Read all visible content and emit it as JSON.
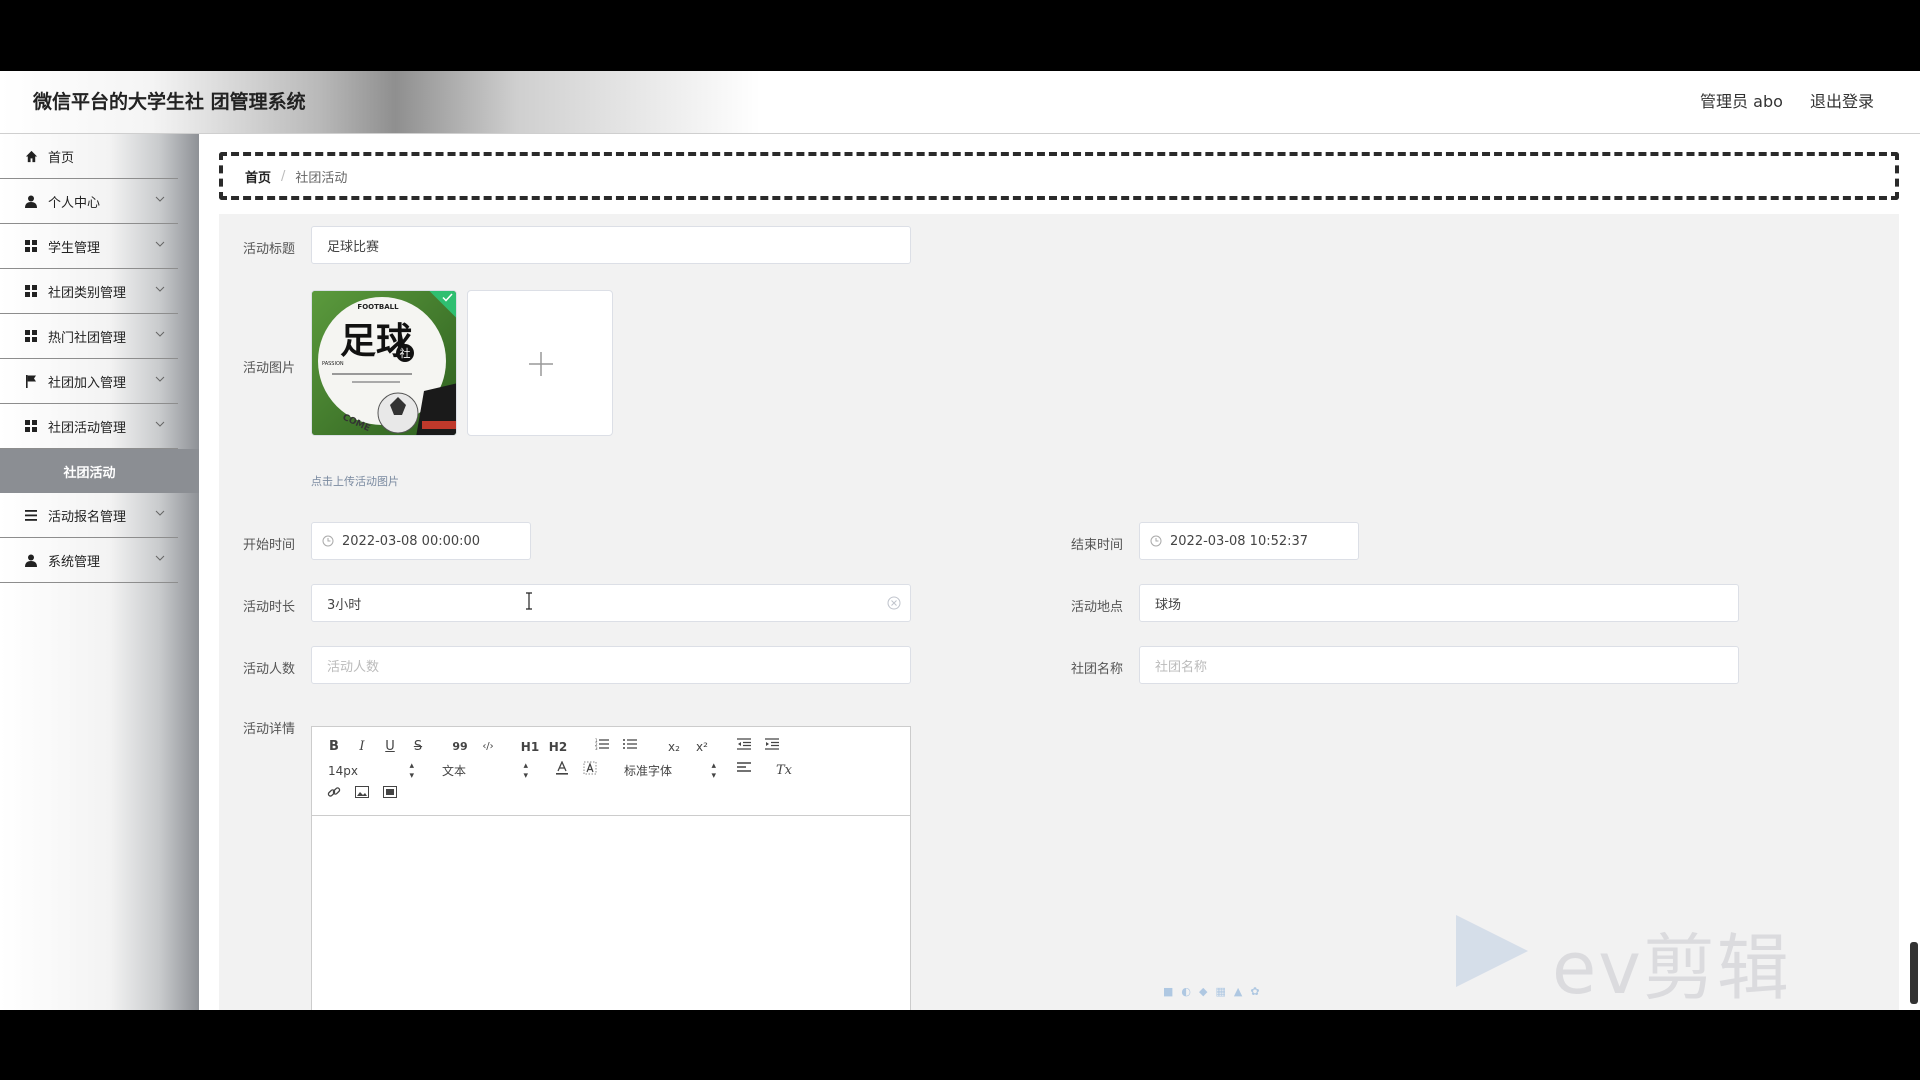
{
  "header": {
    "title": "微信平台的大学生社 团管理系统",
    "admin_label": "管理员 abo",
    "logout_label": "退出登录"
  },
  "sidebar": {
    "items": [
      {
        "label": "首页",
        "icon": "home-icon"
      },
      {
        "label": "个人中心",
        "icon": "user-icon"
      },
      {
        "label": "学生管理",
        "icon": "grid-icon"
      },
      {
        "label": "社团类别管理",
        "icon": "grid-icon"
      },
      {
        "label": "热门社团管理",
        "icon": "grid-icon"
      },
      {
        "label": "社团加入管理",
        "icon": "flag-icon"
      },
      {
        "label": "社团活动管理",
        "icon": "grid-icon"
      },
      {
        "label": "活动报名管理",
        "icon": "list-icon"
      },
      {
        "label": "系统管理",
        "icon": "user-icon"
      }
    ],
    "active_sub": "社团活动"
  },
  "breadcrumb": {
    "home": "首页",
    "separator": "/",
    "current": "社团活动"
  },
  "form": {
    "title_label": "活动标题",
    "title_value": "足球比赛",
    "image_label": "活动图片",
    "image_hint": "点击上传活动图片",
    "image_thumb": {
      "top_text": "FOOTBALL",
      "main_text": "足球",
      "badge_text": "社",
      "side_text": "PASSION",
      "bottom_text": "COME"
    },
    "start_label": "开始时间",
    "start_value": "2022-03-08 00:00:00",
    "end_label": "结束时间",
    "end_value": "2022-03-08 10:52:37",
    "duration_label": "活动时长",
    "duration_value": "3小时",
    "location_label": "活动地点",
    "location_value": "球场",
    "people_label": "活动人数",
    "people_placeholder": "活动人数",
    "club_label": "社团名称",
    "club_placeholder": "社团名称",
    "detail_label": "活动详情"
  },
  "editor": {
    "bold": "B",
    "italic": "I",
    "underline": "U",
    "strike": "S",
    "quote": "99",
    "code": "‹/›",
    "h1": "H1",
    "h2": "H2",
    "sub": "x₂",
    "sup": "x²",
    "size_value": "14px",
    "type_value": "文本",
    "font_value": "标准字体",
    "clean": "Tx"
  },
  "watermark": {
    "text": "ev剪辑"
  },
  "colors": {
    "active_submenu": "#8b8e93",
    "form_background": "#f2f2f2",
    "check_badge": "#2fbf71"
  }
}
